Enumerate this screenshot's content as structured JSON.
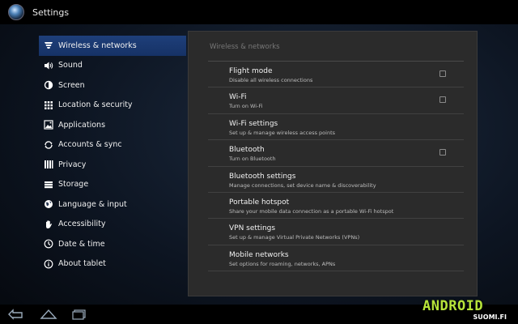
{
  "app": {
    "title": "Settings"
  },
  "sidebar": {
    "items": [
      {
        "label": "Wireless & networks",
        "icon": "wireless-icon",
        "selected": true
      },
      {
        "label": "Sound",
        "icon": "speaker-icon"
      },
      {
        "label": "Screen",
        "icon": "brightness-icon"
      },
      {
        "label": "Location & security",
        "icon": "grid-lock-icon"
      },
      {
        "label": "Applications",
        "icon": "applications-icon"
      },
      {
        "label": "Accounts & sync",
        "icon": "sync-icon"
      },
      {
        "label": "Privacy",
        "icon": "privacy-icon"
      },
      {
        "label": "Storage",
        "icon": "storage-icon"
      },
      {
        "label": "Language & input",
        "icon": "globe-icon"
      },
      {
        "label": "Accessibility",
        "icon": "hand-icon"
      },
      {
        "label": "Date & time",
        "icon": "clock-icon"
      },
      {
        "label": "About tablet",
        "icon": "info-icon"
      }
    ]
  },
  "panel": {
    "header": "Wireless & networks",
    "settings": [
      {
        "title": "Flight mode",
        "summary": "Disable all wireless connections",
        "checkbox": true,
        "checked": false
      },
      {
        "title": "Wi-Fi",
        "summary": "Turn on Wi-Fi",
        "checkbox": true,
        "checked": false
      },
      {
        "title": "Wi-Fi settings",
        "summary": "Set up & manage wireless access points",
        "checkbox": false
      },
      {
        "title": "Bluetooth",
        "summary": "Turn on Bluetooth",
        "checkbox": true,
        "checked": false
      },
      {
        "title": "Bluetooth settings",
        "summary": "Manage connections, set device name & discoverability",
        "checkbox": false
      },
      {
        "title": "Portable hotspot",
        "summary": "Share your mobile data connection as a portable Wi-Fi hotspot",
        "checkbox": false
      },
      {
        "title": "VPN settings",
        "summary": "Set up & manage Virtual Private Networks (VPNs)",
        "checkbox": false
      },
      {
        "title": "Mobile networks",
        "summary": "Set options for roaming, networks, APNs",
        "checkbox": false
      }
    ]
  },
  "navbar": {
    "buttons": [
      "back-icon",
      "home-icon",
      "recent-apps-icon"
    ]
  },
  "watermark": {
    "logo": "ANDROID",
    "sub": "SUOMI.FI"
  },
  "colors": {
    "selected": "#1e3f7a",
    "accent": "#b7e43a",
    "panel": "#2b2b2b"
  }
}
